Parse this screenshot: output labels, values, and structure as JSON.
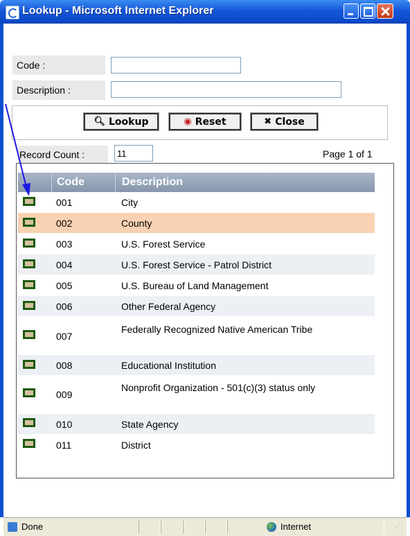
{
  "window": {
    "title": "Lookup - Microsoft Internet Explorer"
  },
  "form": {
    "code_label": "Code :",
    "code_value": "",
    "description_label": "Description :",
    "description_value": ""
  },
  "buttons": {
    "lookup": "Lookup",
    "reset": "Reset",
    "close": "Close"
  },
  "records": {
    "count_label": "Record Count :",
    "count_value": "11",
    "page_info": "Page 1 of 1"
  },
  "grid": {
    "columns": [
      "Code",
      "Description"
    ],
    "rows": [
      {
        "code": "001",
        "description": "City"
      },
      {
        "code": "002",
        "description": "County"
      },
      {
        "code": "003",
        "description": "U.S. Forest Service"
      },
      {
        "code": "004",
        "description": "U.S. Forest Service - Patrol District"
      },
      {
        "code": "005",
        "description": "U.S. Bureau of Land Management"
      },
      {
        "code": "006",
        "description": "Other Federal Agency"
      },
      {
        "code": "007",
        "description": "Federally Recognized Native American Tribe"
      },
      {
        "code": "008",
        "description": "Educational Institution"
      },
      {
        "code": "009",
        "description": "Nonprofit Organization - 501(c)(3) status only"
      },
      {
        "code": "010",
        "description": "State Agency"
      },
      {
        "code": "011",
        "description": "District"
      }
    ],
    "highlighted_row": "002"
  },
  "statusbar": {
    "status": "Done",
    "zone": "Internet"
  },
  "icons": {
    "lookup": "magnifier-icon",
    "reset": "reset-circle-icon",
    "close": "x-icon"
  },
  "colors": {
    "titlebar": "#0a49c9",
    "highlight_row": "#f8d2b2",
    "grid_header": "#8796ad"
  }
}
